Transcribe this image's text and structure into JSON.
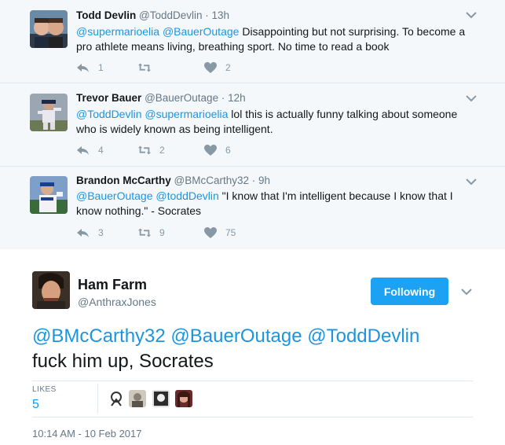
{
  "replies": [
    {
      "name": "Todd Devlin",
      "handle": "@ToddDevlin",
      "time": "· 13h",
      "mentions": [
        "@supermarioelia",
        "@BauerOutage"
      ],
      "text_line1_rest": " Disappointing but not surprising. To become a",
      "text_line2": "pro athlete means living, breathing sport. No time to read a book",
      "reply_count": "1",
      "retweet_count": "",
      "like_count": "2"
    },
    {
      "name": "Trevor Bauer",
      "handle": "@BauerOutage",
      "time": "· 12h",
      "mentions": [
        "@ToddDevlin",
        "@supermarioelia"
      ],
      "text_line1_rest": " lol this is actually funny talking about someone",
      "text_line2": "who is widely known as being intelligent.",
      "reply_count": "4",
      "retweet_count": "2",
      "like_count": "6"
    },
    {
      "name": "Brandon McCarthy",
      "handle": "@BMcCarthy32",
      "time": "· 9h",
      "mentions": [
        "@BauerOutage",
        "@toddDevlin"
      ],
      "text_line1_rest": "  \"I know that I'm intelligent because I know that I",
      "text_line2": "know nothing.\" - Socrates",
      "reply_count": "3",
      "retweet_count": "9",
      "like_count": "75"
    }
  ],
  "main_tweet": {
    "name": "Ham Farm",
    "handle": "@AnthraxJones",
    "follow_label": "Following",
    "mentions": [
      "@BMcCarthy32",
      "@BauerOutage",
      "@ToddDevlin"
    ],
    "text_line2": "fuck him up, Socrates",
    "likes_label": "LIKES",
    "likes_count": "5",
    "timestamp": "10:14 AM - 10 Feb 2017"
  },
  "colors": {
    "link": "#1b95e0",
    "follow_button": "#1da1f2",
    "muted": "#657786",
    "icon": "#8899a6"
  },
  "icons": [
    "reply-icon",
    "retweet-icon",
    "like-icon",
    "chevron-down-icon"
  ]
}
